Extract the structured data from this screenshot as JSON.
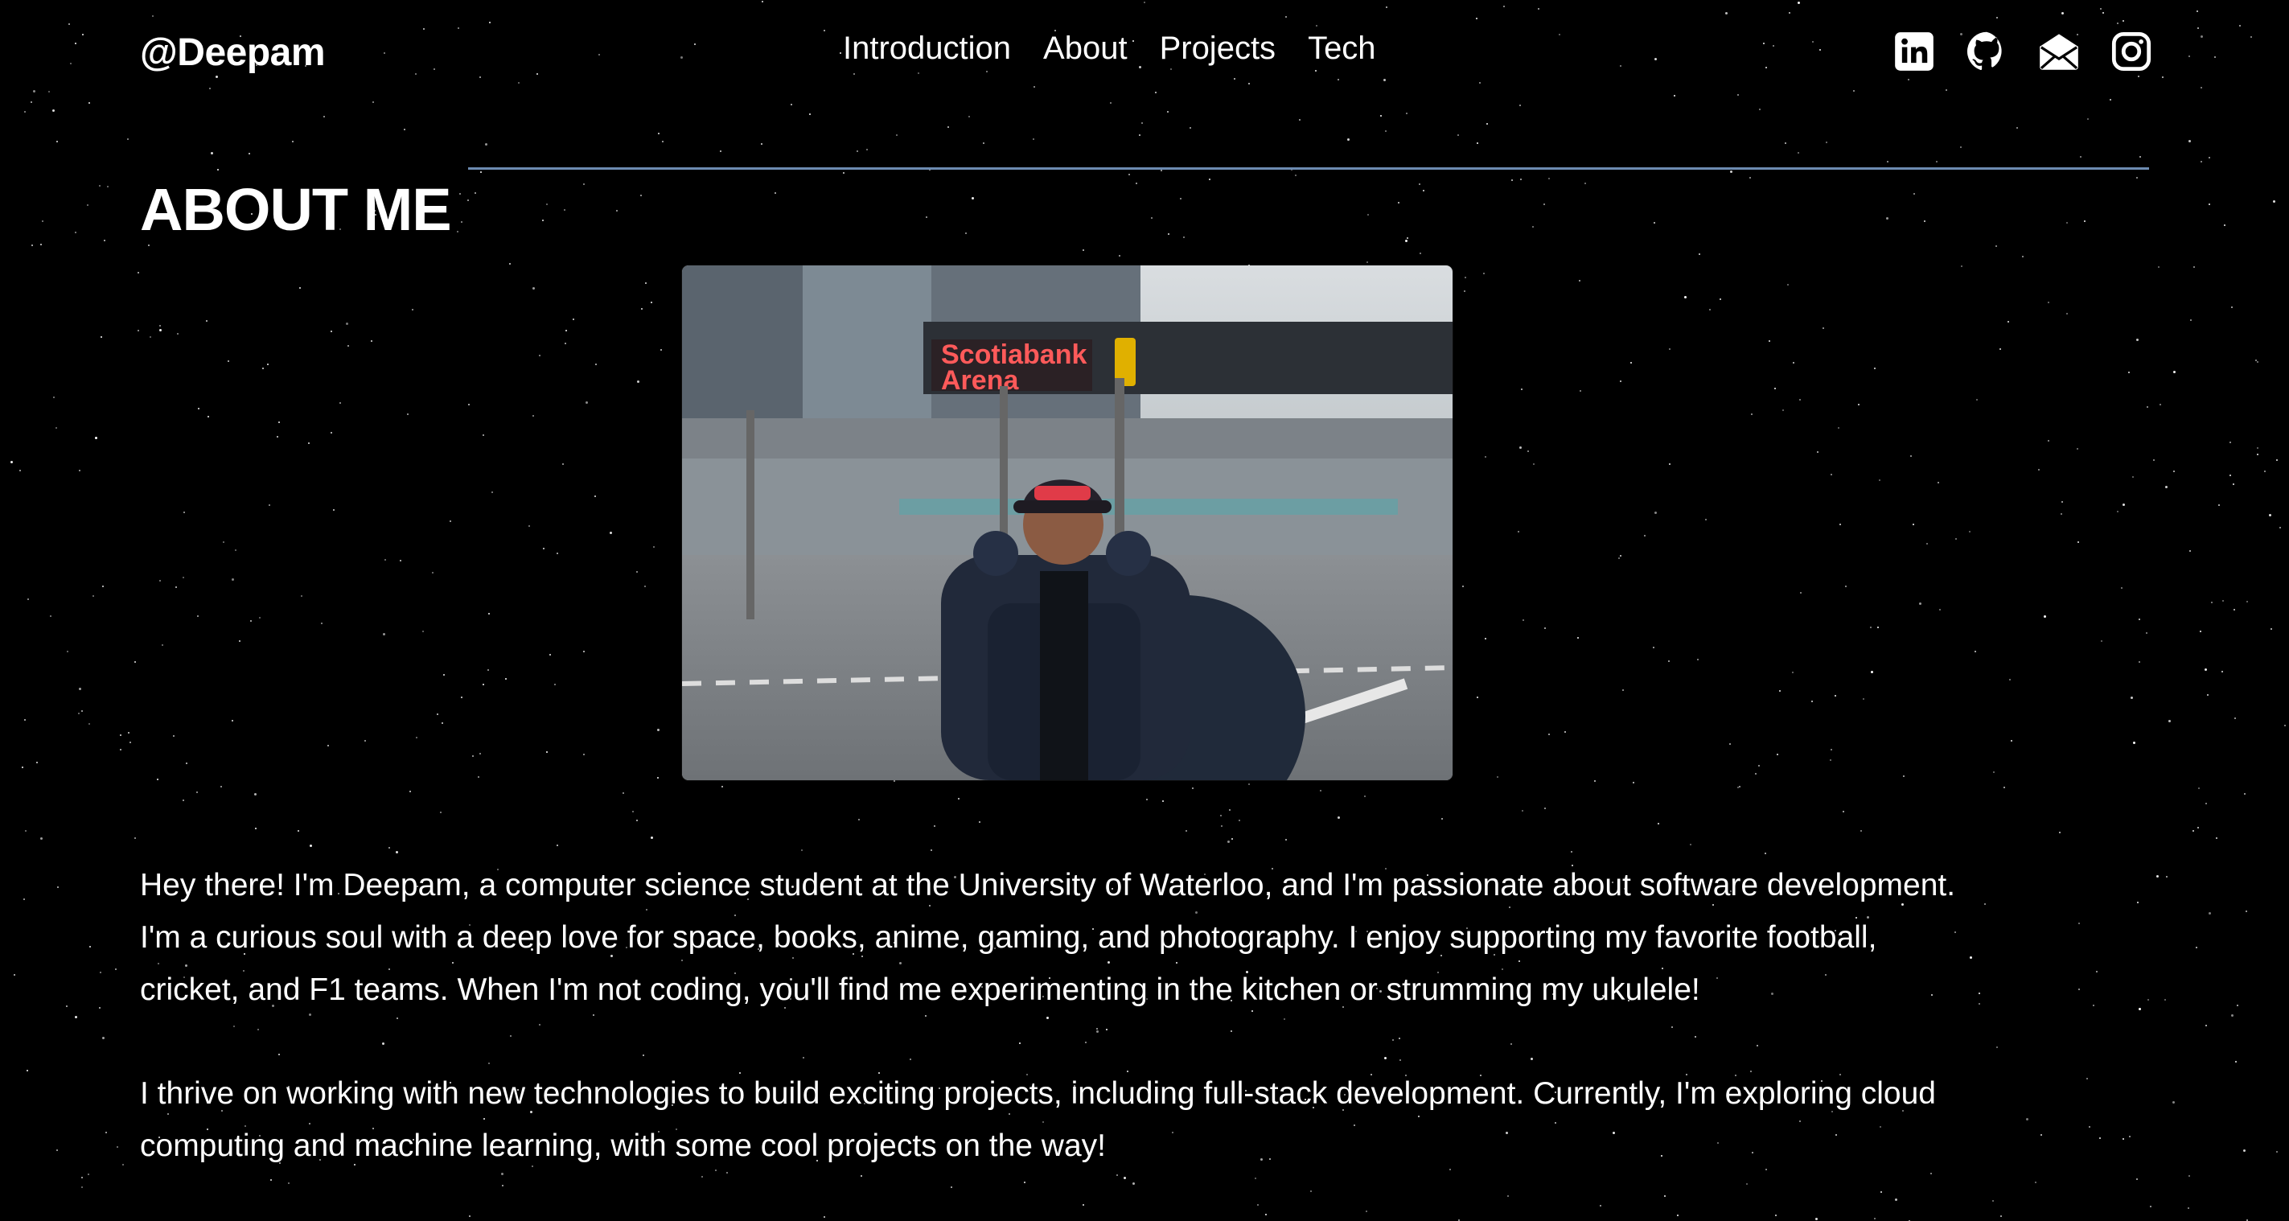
{
  "header": {
    "logo": "@Deepam",
    "nav": [
      "Introduction",
      "About",
      "Projects",
      "Tech"
    ],
    "social_icons": [
      "linkedin-icon",
      "github-icon",
      "mail-icon",
      "instagram-icon"
    ]
  },
  "about": {
    "title": "ABOUT ME",
    "photo_icon": "profile-photo",
    "paragraphs": [
      "Hey there! I'm Deepam, a computer science student at the University of Waterloo, and I'm passionate about software development. I'm a curious soul with a deep love for space, books, anime, gaming, and photography. I enjoy supporting my favorite football, cricket, and F1 teams. When I'm not coding, you'll find me experimenting in the kitchen or strumming my ukulele!",
      "I thrive on working with new technologies to build exciting projects, including full-stack development. Currently, I'm exploring cloud computing and machine learning, with some cool projects on the way!"
    ]
  },
  "colors": {
    "background": "#000000",
    "text": "#ffffff",
    "accent_rule": "#6d8bb1"
  }
}
